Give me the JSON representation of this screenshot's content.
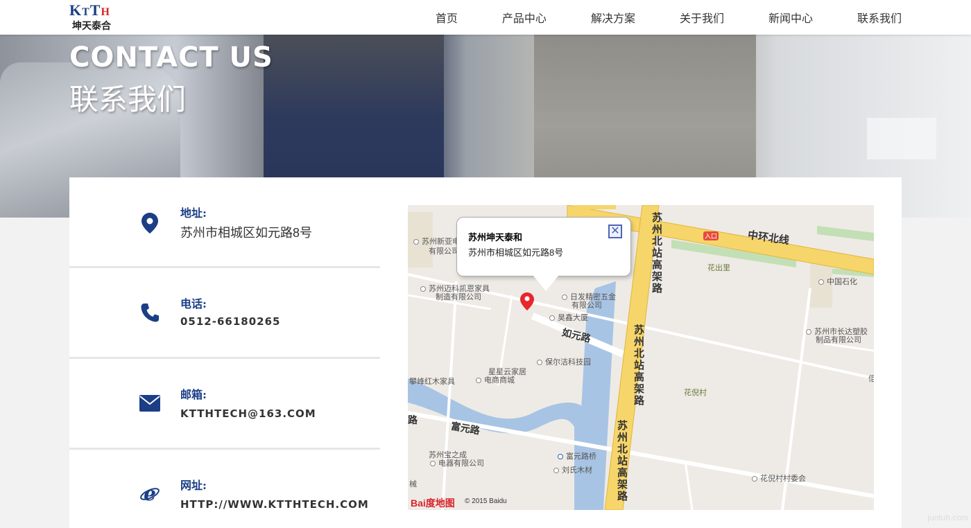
{
  "header": {
    "logo_mark_1": "K",
    "logo_mark_2": "T",
    "logo_mark_3": "T",
    "logo_mark_4": "H",
    "logo_sub": "坤天泰合",
    "nav": [
      "首页",
      "产品中心",
      "解决方案",
      "关于我们",
      "新闻中心",
      "联系我们"
    ]
  },
  "banner": {
    "title_en": "CONTACT US",
    "title_cn": "联系我们"
  },
  "contacts": [
    {
      "label": "地址:",
      "value": "苏州市相城区如元路8号",
      "icon": "location-pin-icon"
    },
    {
      "label": "电话:",
      "value": "0512-66180265",
      "icon": "phone-icon"
    },
    {
      "label": "邮箱:",
      "value": "KTTHTECH@163.COM",
      "icon": "envelope-icon"
    },
    {
      "label": "网址:",
      "value": "HTTP://WWW.KTTHTECH.COM",
      "icon": "ie-browser-icon"
    }
  ],
  "map": {
    "popup_title": "苏州坤天泰和",
    "popup_address": "苏州市相城区如元路8号",
    "popup_close": "✕",
    "labels": {
      "zhonghuan": "中环北线",
      "huachuli": "花出里",
      "zhongguoshihua": "中国石化",
      "entrance": "入口",
      "xinya1": "苏州新亚电",
      "xinya2": "有限公司",
      "maike1": "苏州迈科凯恩家具",
      "maike2": "制造有限公司",
      "rifa1": "日发精密五金",
      "rifa2": "有限公司",
      "haoxin": "昊鑫大厦",
      "ruyuan": "如元路",
      "baoerjie": "保尔洁科技园",
      "xingxing1": "星星云家居",
      "xingxing2": "电商商城",
      "panfeng": "攀峰红木家具",
      "changda1": "苏州市长达塑胶",
      "changda2": "制品有限公司",
      "huanicun": "花倪村",
      "fuyuan": "富元路",
      "fuyuanqiao": "富元路桥",
      "baozhicheng1": "苏州宝之成",
      "baozhicheng2": "电器有限公司",
      "liushi": "刘氏木材",
      "huanicunwei": "花倪村村委会",
      "beizhan": "苏州北站高架路",
      "lu_left": "路",
      "xie": "械",
      "dong": "佢"
    },
    "baidu_logo": "Bai度地图",
    "baidu_copy": "© 2015 Baidu"
  },
  "watermark": "juntuh.com"
}
